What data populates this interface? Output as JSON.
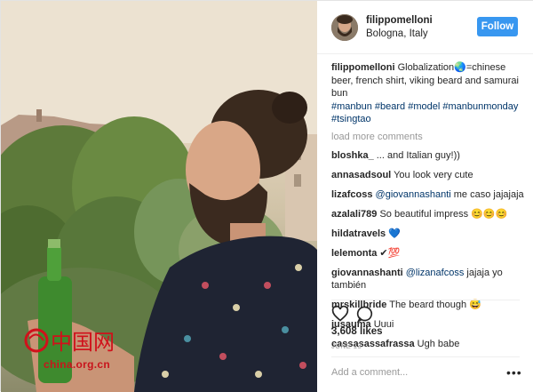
{
  "post": {
    "username": "filippomelloni",
    "location": "Bologna, Italy",
    "follow_label": "Follow",
    "caption_text": "Globalization🌏=chinese beer, french shirt, viking beard and samurai bun",
    "hashtags": "#manbun #beard #model #manbunmonday #tsingtao",
    "load_more": "load more comments"
  },
  "comments": [
    {
      "user": "bloshka_",
      "text": "... and Italian guy!))"
    },
    {
      "user": "annasadsoul",
      "text": "You look very cute"
    },
    {
      "user": "lizafcoss",
      "mention": "@giovannashanti",
      "text": "me caso jajajaja"
    },
    {
      "user": "azalali789",
      "text": "So beautiful impress 😊😊😊"
    },
    {
      "user": "hildatravels",
      "text": "💙"
    },
    {
      "user": "lelemonta",
      "text": "✔💯"
    },
    {
      "user": "giovannashanti",
      "mention": "@lizanafcoss",
      "text": "jajaja yo también"
    },
    {
      "user": "mrskillbride",
      "text": "The beard though 😅"
    },
    {
      "user": "jusauma",
      "text": "Uuui"
    },
    {
      "user": "cassasassafrassa",
      "text": "Ugh babe"
    }
  ],
  "stats": {
    "likes": "3,608 likes",
    "date": "JUNE 13"
  },
  "composer": {
    "placeholder": "Add a comment...",
    "more": "•••"
  },
  "watermark": {
    "text": "china.org.cn",
    "logo_text": "中国网"
  },
  "colors": {
    "follow": "#3897f0",
    "link": "#003569",
    "muted": "#999999"
  }
}
